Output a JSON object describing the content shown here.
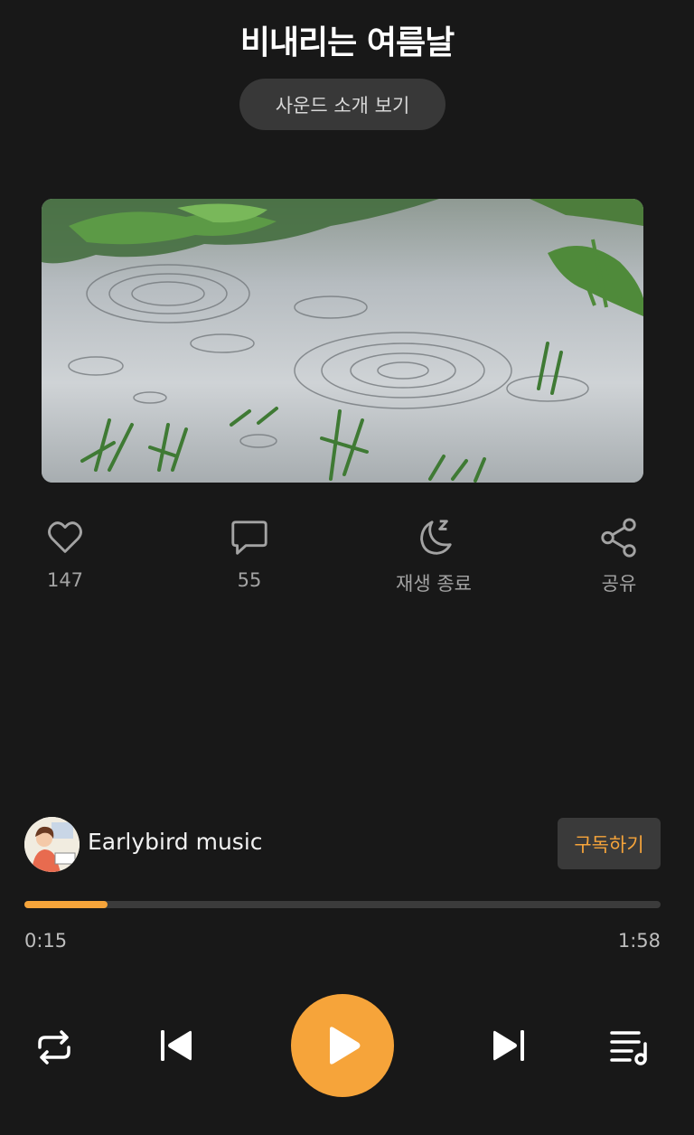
{
  "header": {
    "title": "비내리는 여름날",
    "intro_button": "사운드 소개 보기"
  },
  "cover": {
    "description": "rain-on-water-photo"
  },
  "actions": [
    {
      "name": "like",
      "icon": "heart-icon",
      "label": "147"
    },
    {
      "name": "comments",
      "icon": "comment-icon",
      "label": "55"
    },
    {
      "name": "sleep-timer",
      "icon": "moon-sleep-icon",
      "label": "재생 종료"
    },
    {
      "name": "share",
      "icon": "share-icon",
      "label": "공유"
    }
  ],
  "channel": {
    "name": "Earlybird music",
    "subscribe_label": "구독하기",
    "avatar_icon": "channel-avatar"
  },
  "player": {
    "progress": 0.13,
    "current_time": "0:15",
    "total_time": "1:58",
    "controls": [
      "repeat-icon",
      "previous-icon",
      "play-icon",
      "next-icon",
      "playlist-icon"
    ]
  },
  "colors": {
    "accent": "#f6a43a",
    "background": "#181818",
    "muted_text": "#a3a3a3",
    "button_bg": "#383838"
  }
}
